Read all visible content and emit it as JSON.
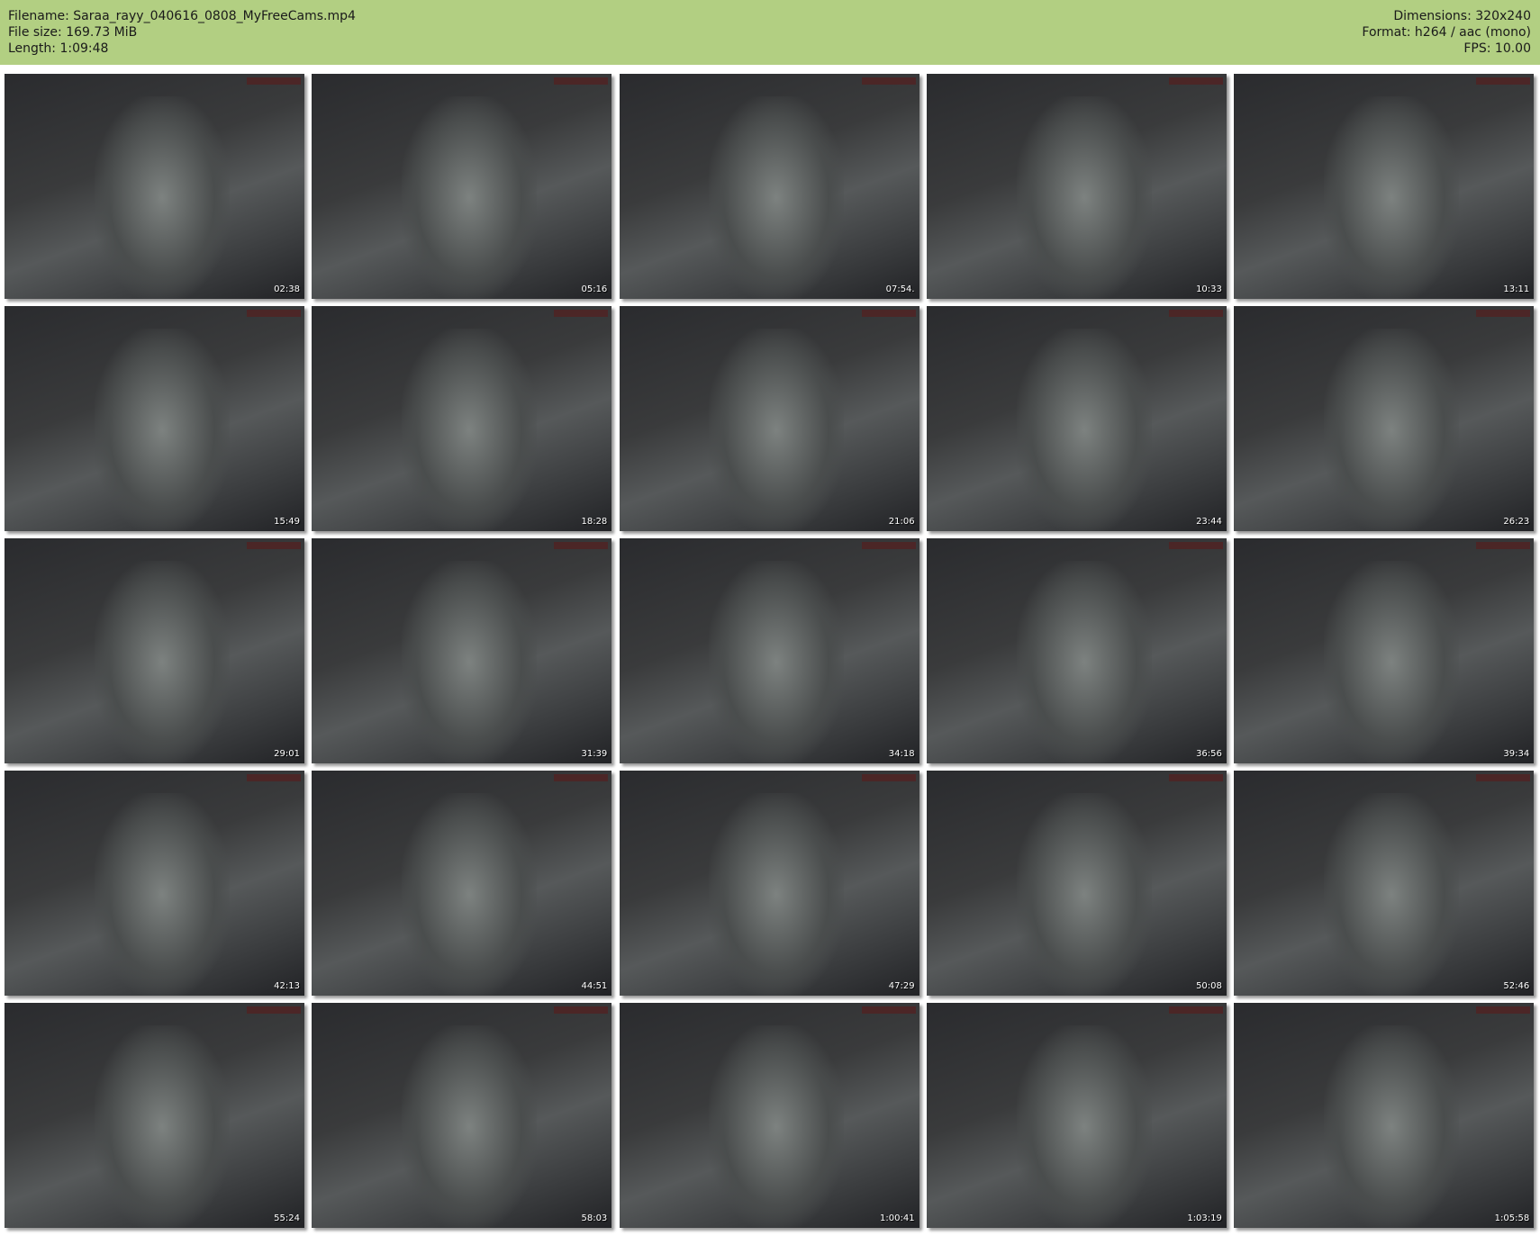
{
  "header": {
    "filename": "Filename: Saraa_rayy_040616_0808_MyFreeCams.mp4",
    "filesize": "File size: 169.73 MiB",
    "length": "Length: 1:09:48",
    "dimensions": "Dimensions: 320x240",
    "format": "Format: h264 / aac (mono)",
    "fps": "FPS: 10.00"
  },
  "colors": {
    "header_bg": "#b2cf82"
  },
  "thumbnails": [
    {
      "time": "02:38"
    },
    {
      "time": "05:16"
    },
    {
      "time": "07:54."
    },
    {
      "time": "10:33"
    },
    {
      "time": "13:11"
    },
    {
      "time": "15:49"
    },
    {
      "time": "18:28"
    },
    {
      "time": "21:06"
    },
    {
      "time": "23:44"
    },
    {
      "time": "26:23"
    },
    {
      "time": "29:01"
    },
    {
      "time": "31:39"
    },
    {
      "time": "34:18"
    },
    {
      "time": "36:56"
    },
    {
      "time": "39:34"
    },
    {
      "time": "42:13"
    },
    {
      "time": "44:51"
    },
    {
      "time": "47:29"
    },
    {
      "time": "50:08"
    },
    {
      "time": "52:46"
    },
    {
      "time": "55:24"
    },
    {
      "time": "58:03"
    },
    {
      "time": "1:00:41"
    },
    {
      "time": "1:03:19"
    },
    {
      "time": "1:05:58"
    }
  ]
}
